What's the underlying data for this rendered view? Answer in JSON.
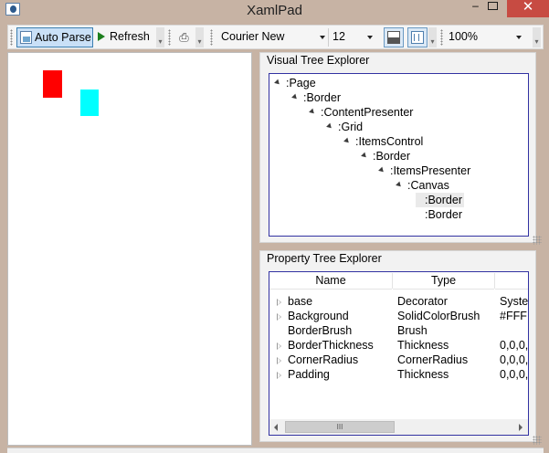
{
  "window": {
    "title": "XamlPad",
    "minimize_glyph": "–",
    "close_glyph": "✕"
  },
  "toolbar": {
    "auto_parse_label": "Auto Parse",
    "auto_parse_checked": true,
    "refresh_label": "Refresh",
    "print_icon": "print-icon",
    "font_family": "Courier New",
    "font_size": "12",
    "zoom": "100%",
    "overflow_glyph": "▾"
  },
  "canvas": {
    "shapes": [
      {
        "name": "red-rectangle",
        "color": "#ff0000"
      },
      {
        "name": "cyan-rectangle",
        "color": "#00ffff"
      }
    ]
  },
  "visual_tree": {
    "title": "Visual Tree Explorer",
    "nodes": [
      {
        "label": ":Page",
        "depth": 0,
        "expanded": true
      },
      {
        "label": ":Border",
        "depth": 1,
        "expanded": true
      },
      {
        "label": ":ContentPresenter",
        "depth": 2,
        "expanded": true
      },
      {
        "label": ":Grid",
        "depth": 3,
        "expanded": true
      },
      {
        "label": ":ItemsControl",
        "depth": 4,
        "expanded": true
      },
      {
        "label": ":Border",
        "depth": 5,
        "expanded": true
      },
      {
        "label": ":ItemsPresenter",
        "depth": 6,
        "expanded": true
      },
      {
        "label": ":Canvas",
        "depth": 7,
        "expanded": true
      },
      {
        "label": ":Border",
        "depth": 8,
        "expanded": false,
        "selected": true
      },
      {
        "label": ":Border",
        "depth": 8,
        "expanded": false
      }
    ]
  },
  "property_tree": {
    "title": "Property Tree Explorer",
    "columns": [
      "Name",
      "Type"
    ],
    "rows": [
      {
        "name": "base",
        "type": "Decorator",
        "value": "Syste",
        "expandable": true
      },
      {
        "name": "Background",
        "type": "SolidColorBrush",
        "value": "#FFFI",
        "expandable": true
      },
      {
        "name": "BorderBrush",
        "type": "Brush",
        "value": "",
        "expandable": false
      },
      {
        "name": "BorderThickness",
        "type": "Thickness",
        "value": "0,0,0,",
        "expandable": true
      },
      {
        "name": "CornerRadius",
        "type": "CornerRadius",
        "value": "0,0,0,",
        "expandable": true
      },
      {
        "name": "Padding",
        "type": "Thickness",
        "value": "0,0,0,",
        "expandable": true
      }
    ],
    "scroll_thumb_glyph": "III"
  }
}
